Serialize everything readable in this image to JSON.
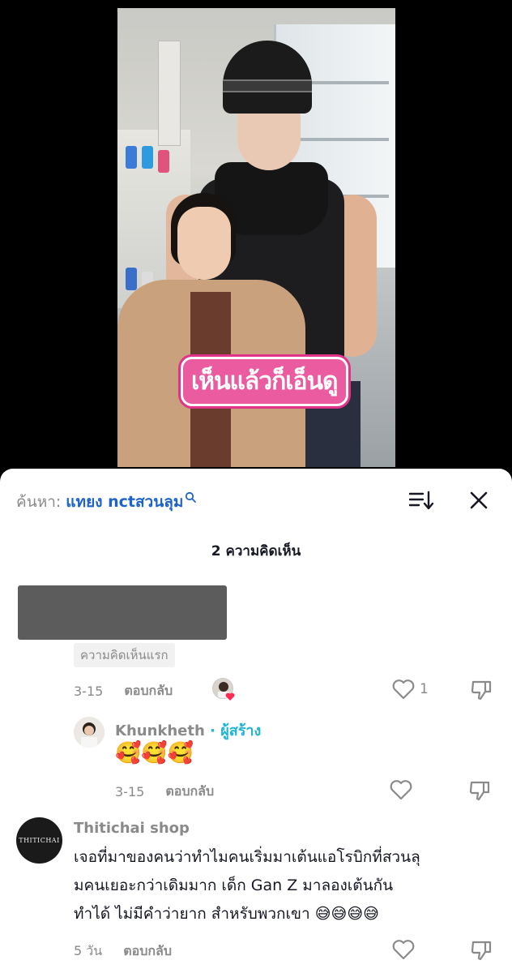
{
  "video": {
    "overlay_text": "เห็นแล้วก็เอ็นดู"
  },
  "sheet": {
    "search_label": "ค้นหา:",
    "search_term": "แทยง nctสวนลุม",
    "comment_count": "2 ความคิดเห็น"
  },
  "comments": [
    {
      "first_tag": "ความคิดเห็นแรก",
      "time": "3-15",
      "reply_label": "ตอบกลับ",
      "likes": "1",
      "replies": [
        {
          "name": "Khunkheth",
          "creator_label": "· ผู้สร้าง",
          "text": "🥰🥰🥰",
          "time": "3-15",
          "reply_label": "ตอบกลับ"
        }
      ]
    },
    {
      "name": "Thitichai shop",
      "avatar_text": "THITICHAI",
      "text_lines": [
        "เจอที่มาของคนว่าทำไมคนเริ่มมาเต้นแอโรบิกที่สวนลุ",
        "มคนเยอะกว่าเดิมมาก เด็ก Gan Z มาลองเต้นกัน",
        "ทำได้ ไม่มีคำว่ายาก สำหรับพวกเขา 😅😅😅😅"
      ],
      "time": "5 วัน",
      "reply_label": "ตอบกลับ"
    }
  ],
  "colors": {
    "accent_blue": "#1e63c9",
    "creator_cyan": "#20b4d6",
    "muted": "#8a8a8a"
  }
}
